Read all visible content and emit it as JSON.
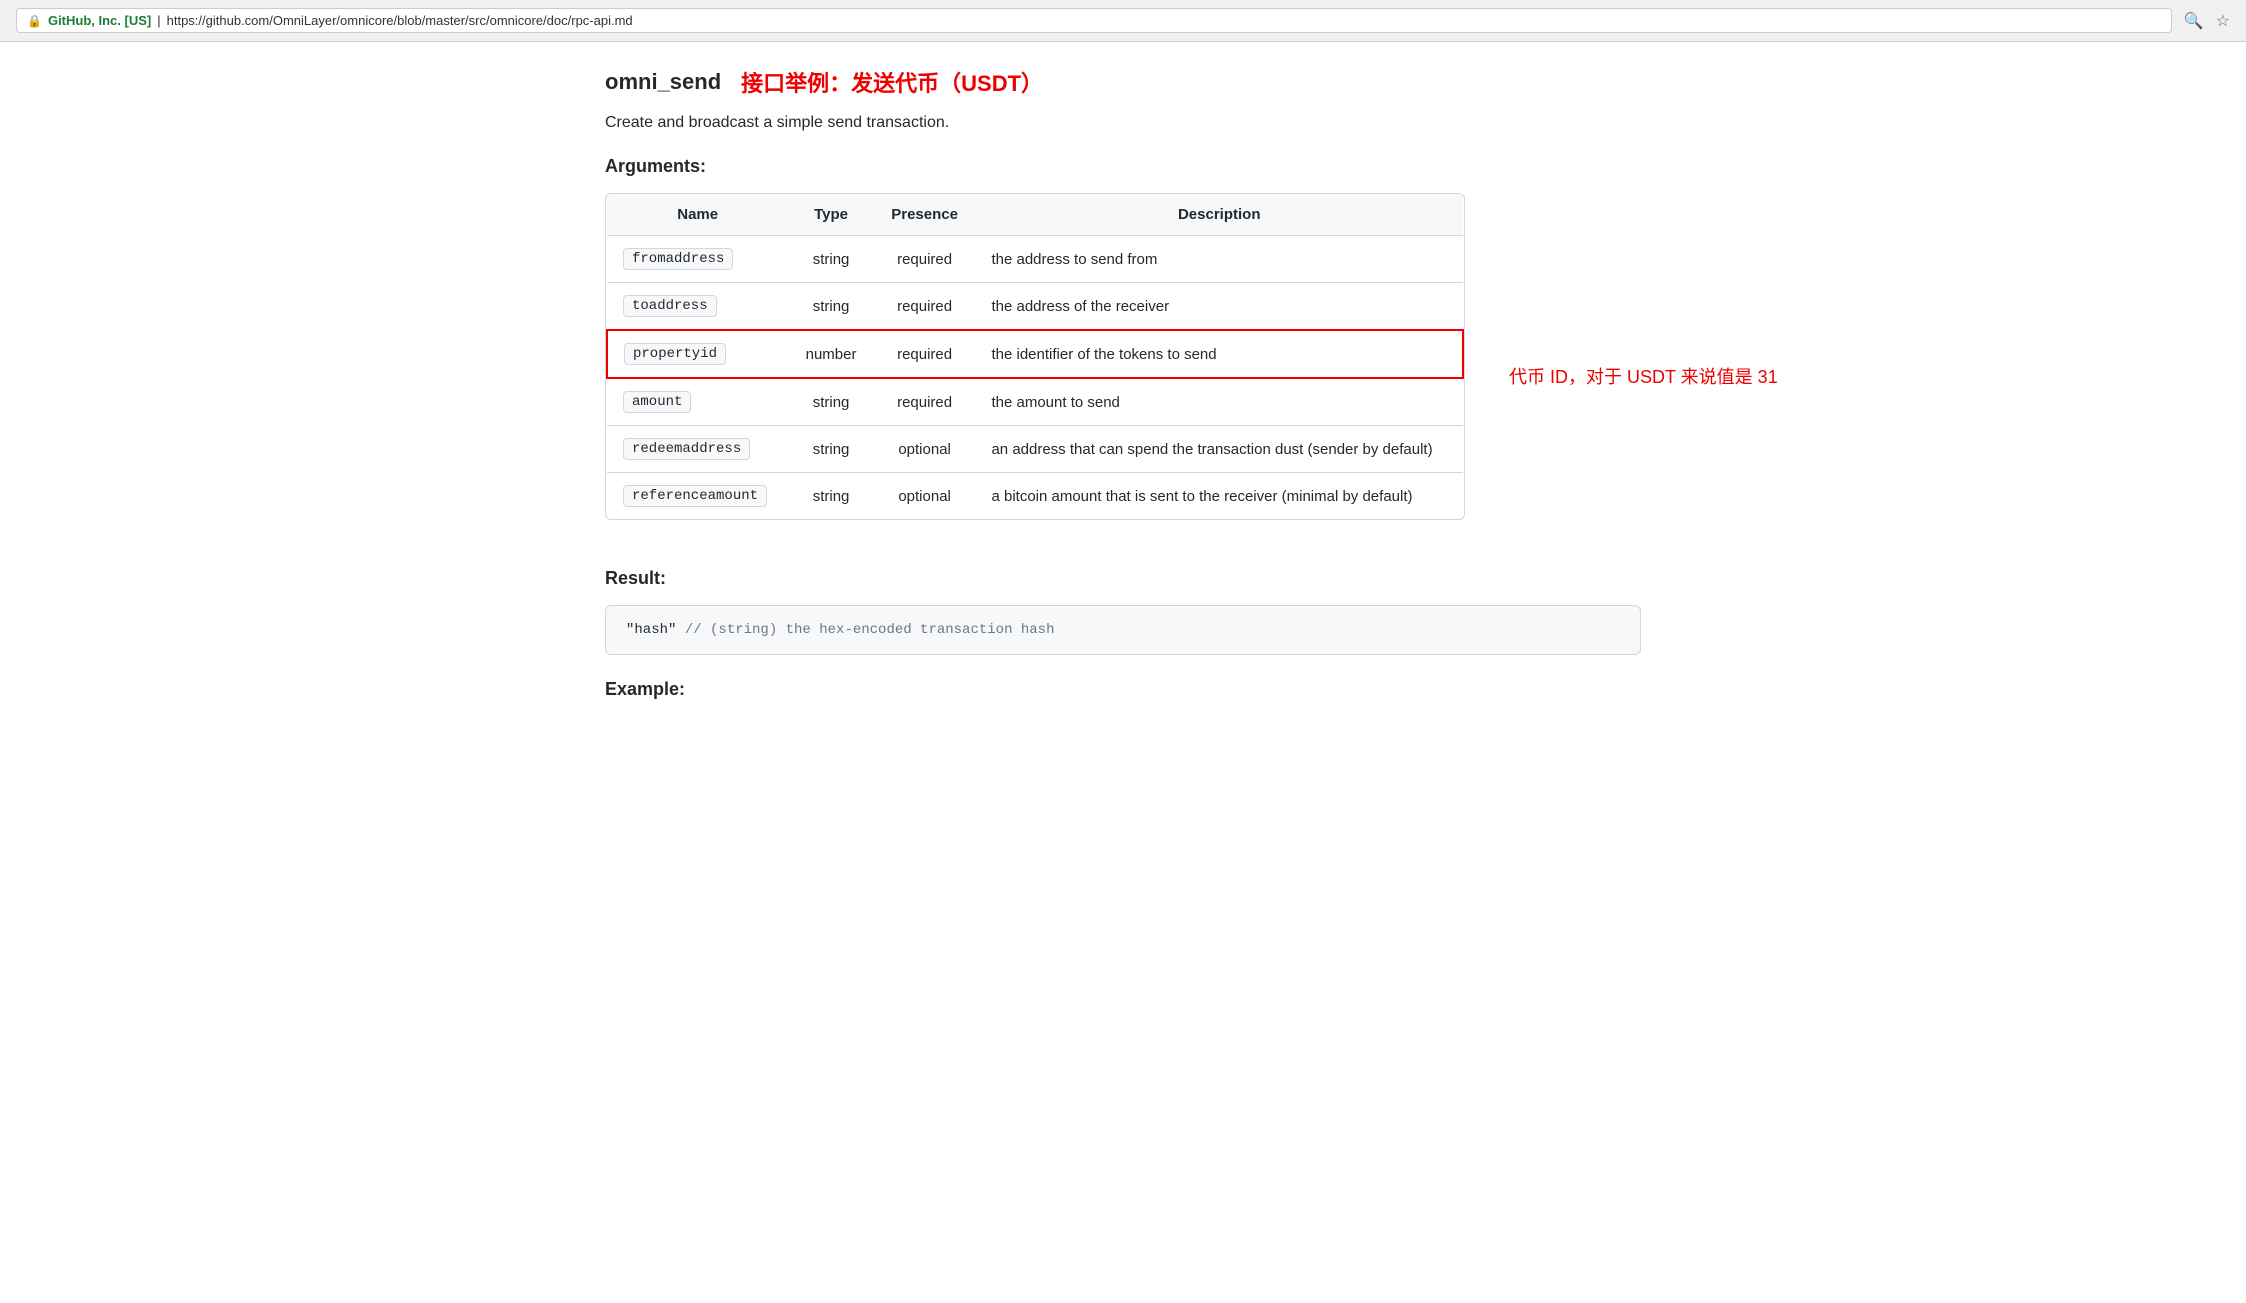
{
  "browser": {
    "site_info": "GitHub, Inc. [US]",
    "url": "https://github.com/OmniLayer/omnicore/blob/master/src/omnicore/doc/rpc-api.md",
    "url_prefix": "https://",
    "url_domain": "github.com",
    "url_path": "/OmniLayer/omnicore/blob/master/src/omnicore/doc/rpc-api.md"
  },
  "page": {
    "function_name": "omni_send",
    "chinese_title": "接口举例：发送代币（USDT）",
    "description": "Create and broadcast a simple send transaction.",
    "arguments_label": "Arguments:",
    "result_label": "Result:",
    "example_label": "Example:",
    "table": {
      "headers": [
        "Name",
        "Type",
        "Presence",
        "Description"
      ],
      "rows": [
        {
          "name": "fromaddress",
          "type": "string",
          "presence": "required",
          "description": "the address to send from",
          "highlighted": false
        },
        {
          "name": "toaddress",
          "type": "string",
          "presence": "required",
          "description": "the address of the receiver",
          "highlighted": false
        },
        {
          "name": "propertyid",
          "type": "number",
          "presence": "required",
          "description": "the identifier of the tokens to send",
          "highlighted": true,
          "annotation": "代币 ID，对于 USDT 来说值是 31"
        },
        {
          "name": "amount",
          "type": "string",
          "presence": "required",
          "description": "the amount to send",
          "highlighted": false
        },
        {
          "name": "redeemaddress",
          "type": "string",
          "presence": "optional",
          "description": "an address that can spend the transaction dust (sender by default)",
          "highlighted": false
        },
        {
          "name": "referenceamount",
          "type": "string",
          "presence": "optional",
          "description": "a bitcoin amount that is sent to the receiver (minimal by default)",
          "highlighted": false
        }
      ]
    },
    "code_block": "\"hash\"  // (string) the hex-encoded transaction hash"
  }
}
